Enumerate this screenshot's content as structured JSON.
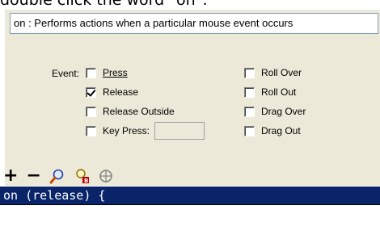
{
  "top_caption": "double click the word \"on\":",
  "description": "on : Performs actions when a particular mouse event occurs",
  "event_label": "Event:",
  "options_left": [
    {
      "label": "Press",
      "checked": false
    },
    {
      "label": "Release",
      "checked": true
    },
    {
      "label": "Release Outside",
      "checked": false
    },
    {
      "label": "Key Press:",
      "checked": false
    }
  ],
  "options_right": [
    {
      "label": "Roll Over",
      "checked": false
    },
    {
      "label": "Roll Out",
      "checked": false
    },
    {
      "label": "Drag Over",
      "checked": false
    },
    {
      "label": "Drag Out",
      "checked": false
    }
  ],
  "toolbar": {
    "add": "+",
    "remove": "−",
    "icons": [
      "find-icon",
      "replace-icon",
      "target-icon"
    ]
  },
  "code_line": "on (release) {",
  "colors": {
    "selection": "#0a246a",
    "panel": "#ece9d8"
  }
}
